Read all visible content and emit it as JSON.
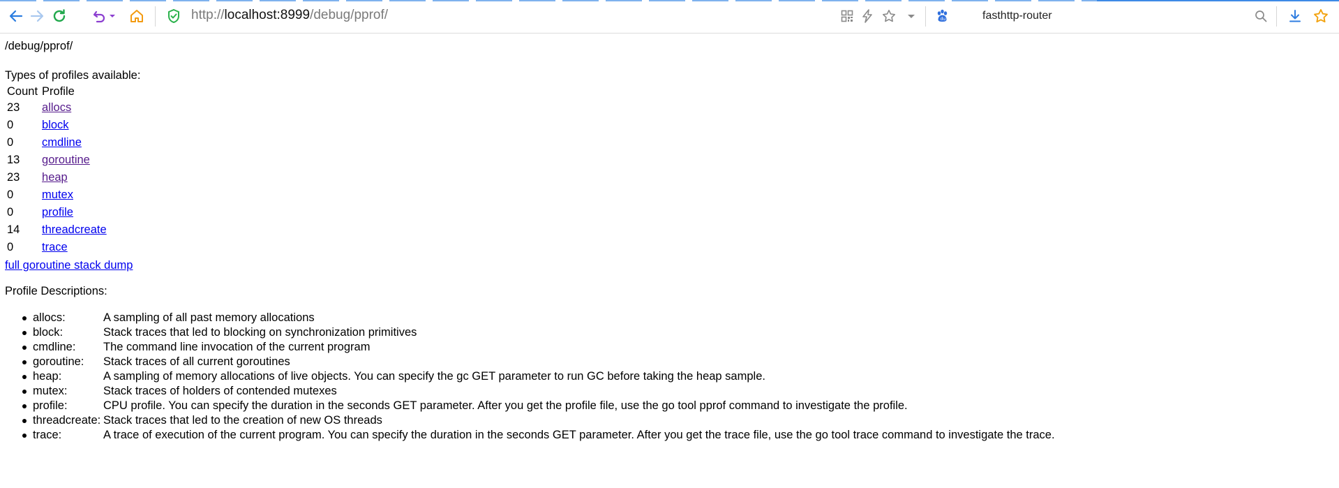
{
  "browser": {
    "url_prefix": "http://",
    "url_host": "localhost:8999",
    "url_path": "/debug/pprof/",
    "search_engine_label": "fasthttp-router",
    "accent_color": "#3d8ae6",
    "icons": [
      "back-icon",
      "forward-icon",
      "reload-icon",
      "undo-icon",
      "dropdown-icon",
      "home-icon",
      "shield-icon",
      "qr-code-icon",
      "lightning-icon",
      "star-icon",
      "chevron-down-icon",
      "paw-icon",
      "search-icon",
      "download-icon",
      "favorites-star-icon"
    ]
  },
  "page": {
    "path_heading": "/debug/pprof/",
    "types_heading": "Types of profiles available:",
    "table_headers": {
      "count": "Count",
      "profile": "Profile"
    },
    "profiles": [
      {
        "count": "23",
        "name": "allocs",
        "visited": true
      },
      {
        "count": "0",
        "name": "block",
        "visited": false
      },
      {
        "count": "0",
        "name": "cmdline",
        "visited": false
      },
      {
        "count": "13",
        "name": "goroutine",
        "visited": true
      },
      {
        "count": "23",
        "name": "heap",
        "visited": true
      },
      {
        "count": "0",
        "name": "mutex",
        "visited": false
      },
      {
        "count": "0",
        "name": "profile",
        "visited": false
      },
      {
        "count": "14",
        "name": "threadcreate",
        "visited": false
      },
      {
        "count": "0",
        "name": "trace",
        "visited": false
      }
    ],
    "full_dump_link": "full goroutine stack dump",
    "descriptions_heading": "Profile Descriptions:",
    "descriptions": [
      {
        "name": "allocs:",
        "text": "A sampling of all past memory allocations"
      },
      {
        "name": "block:",
        "text": "Stack traces that led to blocking on synchronization primitives"
      },
      {
        "name": "cmdline:",
        "text": "The command line invocation of the current program"
      },
      {
        "name": "goroutine:",
        "text": "Stack traces of all current goroutines"
      },
      {
        "name": "heap:",
        "text": "A sampling of memory allocations of live objects. You can specify the gc GET parameter to run GC before taking the heap sample."
      },
      {
        "name": "mutex:",
        "text": "Stack traces of holders of contended mutexes"
      },
      {
        "name": "profile:",
        "text": "CPU profile. You can specify the duration in the seconds GET parameter. After you get the profile file, use the go tool pprof command to investigate the profile."
      },
      {
        "name": "threadcreate:",
        "text": "Stack traces that led to the creation of new OS threads"
      },
      {
        "name": "trace:",
        "text": "A trace of execution of the current program. You can specify the duration in the seconds GET parameter. After you get the trace file, use the go tool trace command to investigate the trace."
      }
    ],
    "link_color": "#0000ee",
    "visited_link_color": "#551a8b"
  }
}
